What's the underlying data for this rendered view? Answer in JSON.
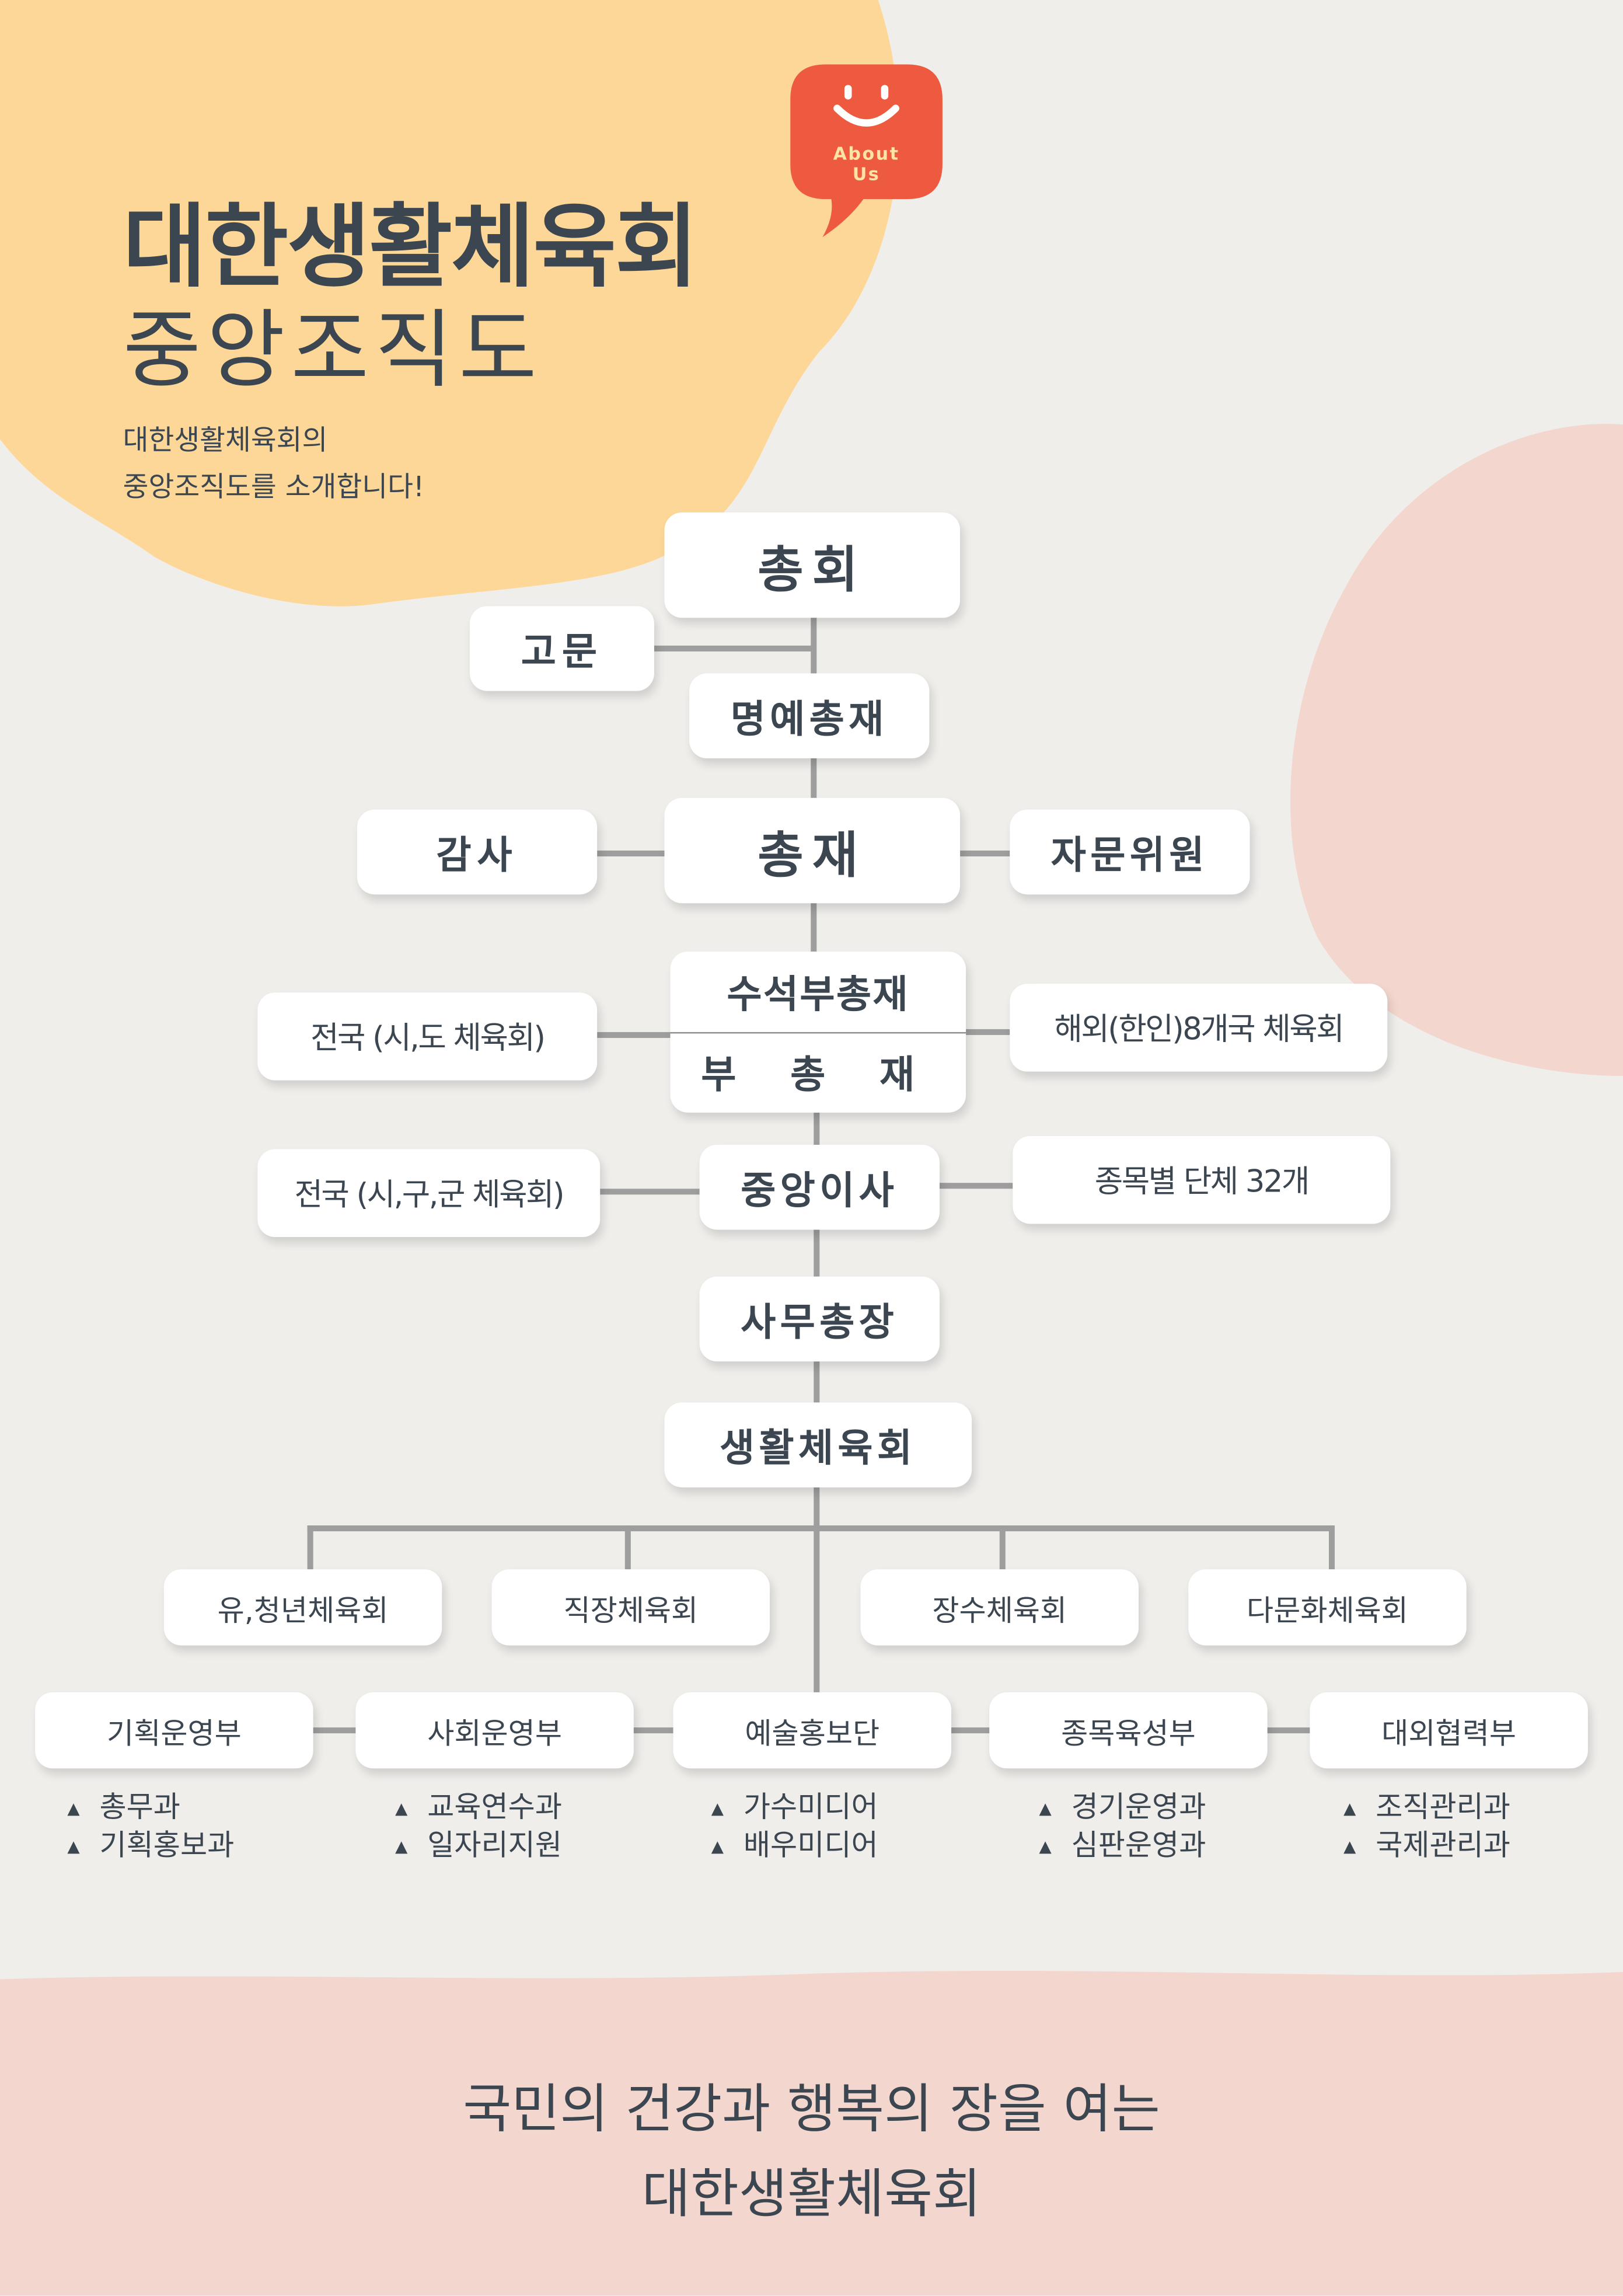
{
  "header": {
    "title": "대한생활체육회",
    "subtitle": "중앙조직도",
    "description_line1": "대한생활체육회의",
    "description_line2": "중앙조직도를 소개합니다!",
    "badge_line1": "About",
    "badge_line2": "Us"
  },
  "org": {
    "general_assembly": "총회",
    "advisor": "고문",
    "honorary_president": "명예총재",
    "president": "총재",
    "auditor": "감사",
    "advisory_committee": "자문위원",
    "senior_vice_president": "수석부총재",
    "vice_president": "부 총 재",
    "national_city_province": "전국 (시,도 체육회)",
    "overseas": "해외(한인)8개국 체육회",
    "central_directors": "중앙이사",
    "national_city_county": "전국 (시,구,군 체육회)",
    "sport_organizations": "종목별 단체 32개",
    "secretary_general": "사무총장",
    "association": "생활체육회",
    "groups": [
      "유,청년체육회",
      "직장체육회",
      "장수체육회",
      "다문화체육회"
    ],
    "departments": [
      {
        "name": "기획운영부",
        "subs": [
          "총무과",
          "기획홍보과"
        ]
      },
      {
        "name": "사회운영부",
        "subs": [
          "교육연수과",
          "일자리지원"
        ]
      },
      {
        "name": "예술홍보단",
        "subs": [
          "가수미디어",
          "배우미디어"
        ]
      },
      {
        "name": "종목육성부",
        "subs": [
          "경기운영과",
          "심판운영과"
        ]
      },
      {
        "name": "대외협력부",
        "subs": [
          "조직관리과",
          "국제관리과"
        ]
      }
    ]
  },
  "footer": {
    "line1": "국민의 건강과 행복의 장을 여는",
    "line2": "대한생활체육회"
  },
  "colors": {
    "background": "#f0eeeb",
    "yellow_blob": "#fdd797",
    "pink_blob": "#f3d7ce",
    "footer_band": "#f3d7ce",
    "badge": "#ee5a3f",
    "text": "#3c4650",
    "connector": "#9e9e9e"
  },
  "icons": [
    "smile-icon",
    "triangle-bullet-icon"
  ]
}
